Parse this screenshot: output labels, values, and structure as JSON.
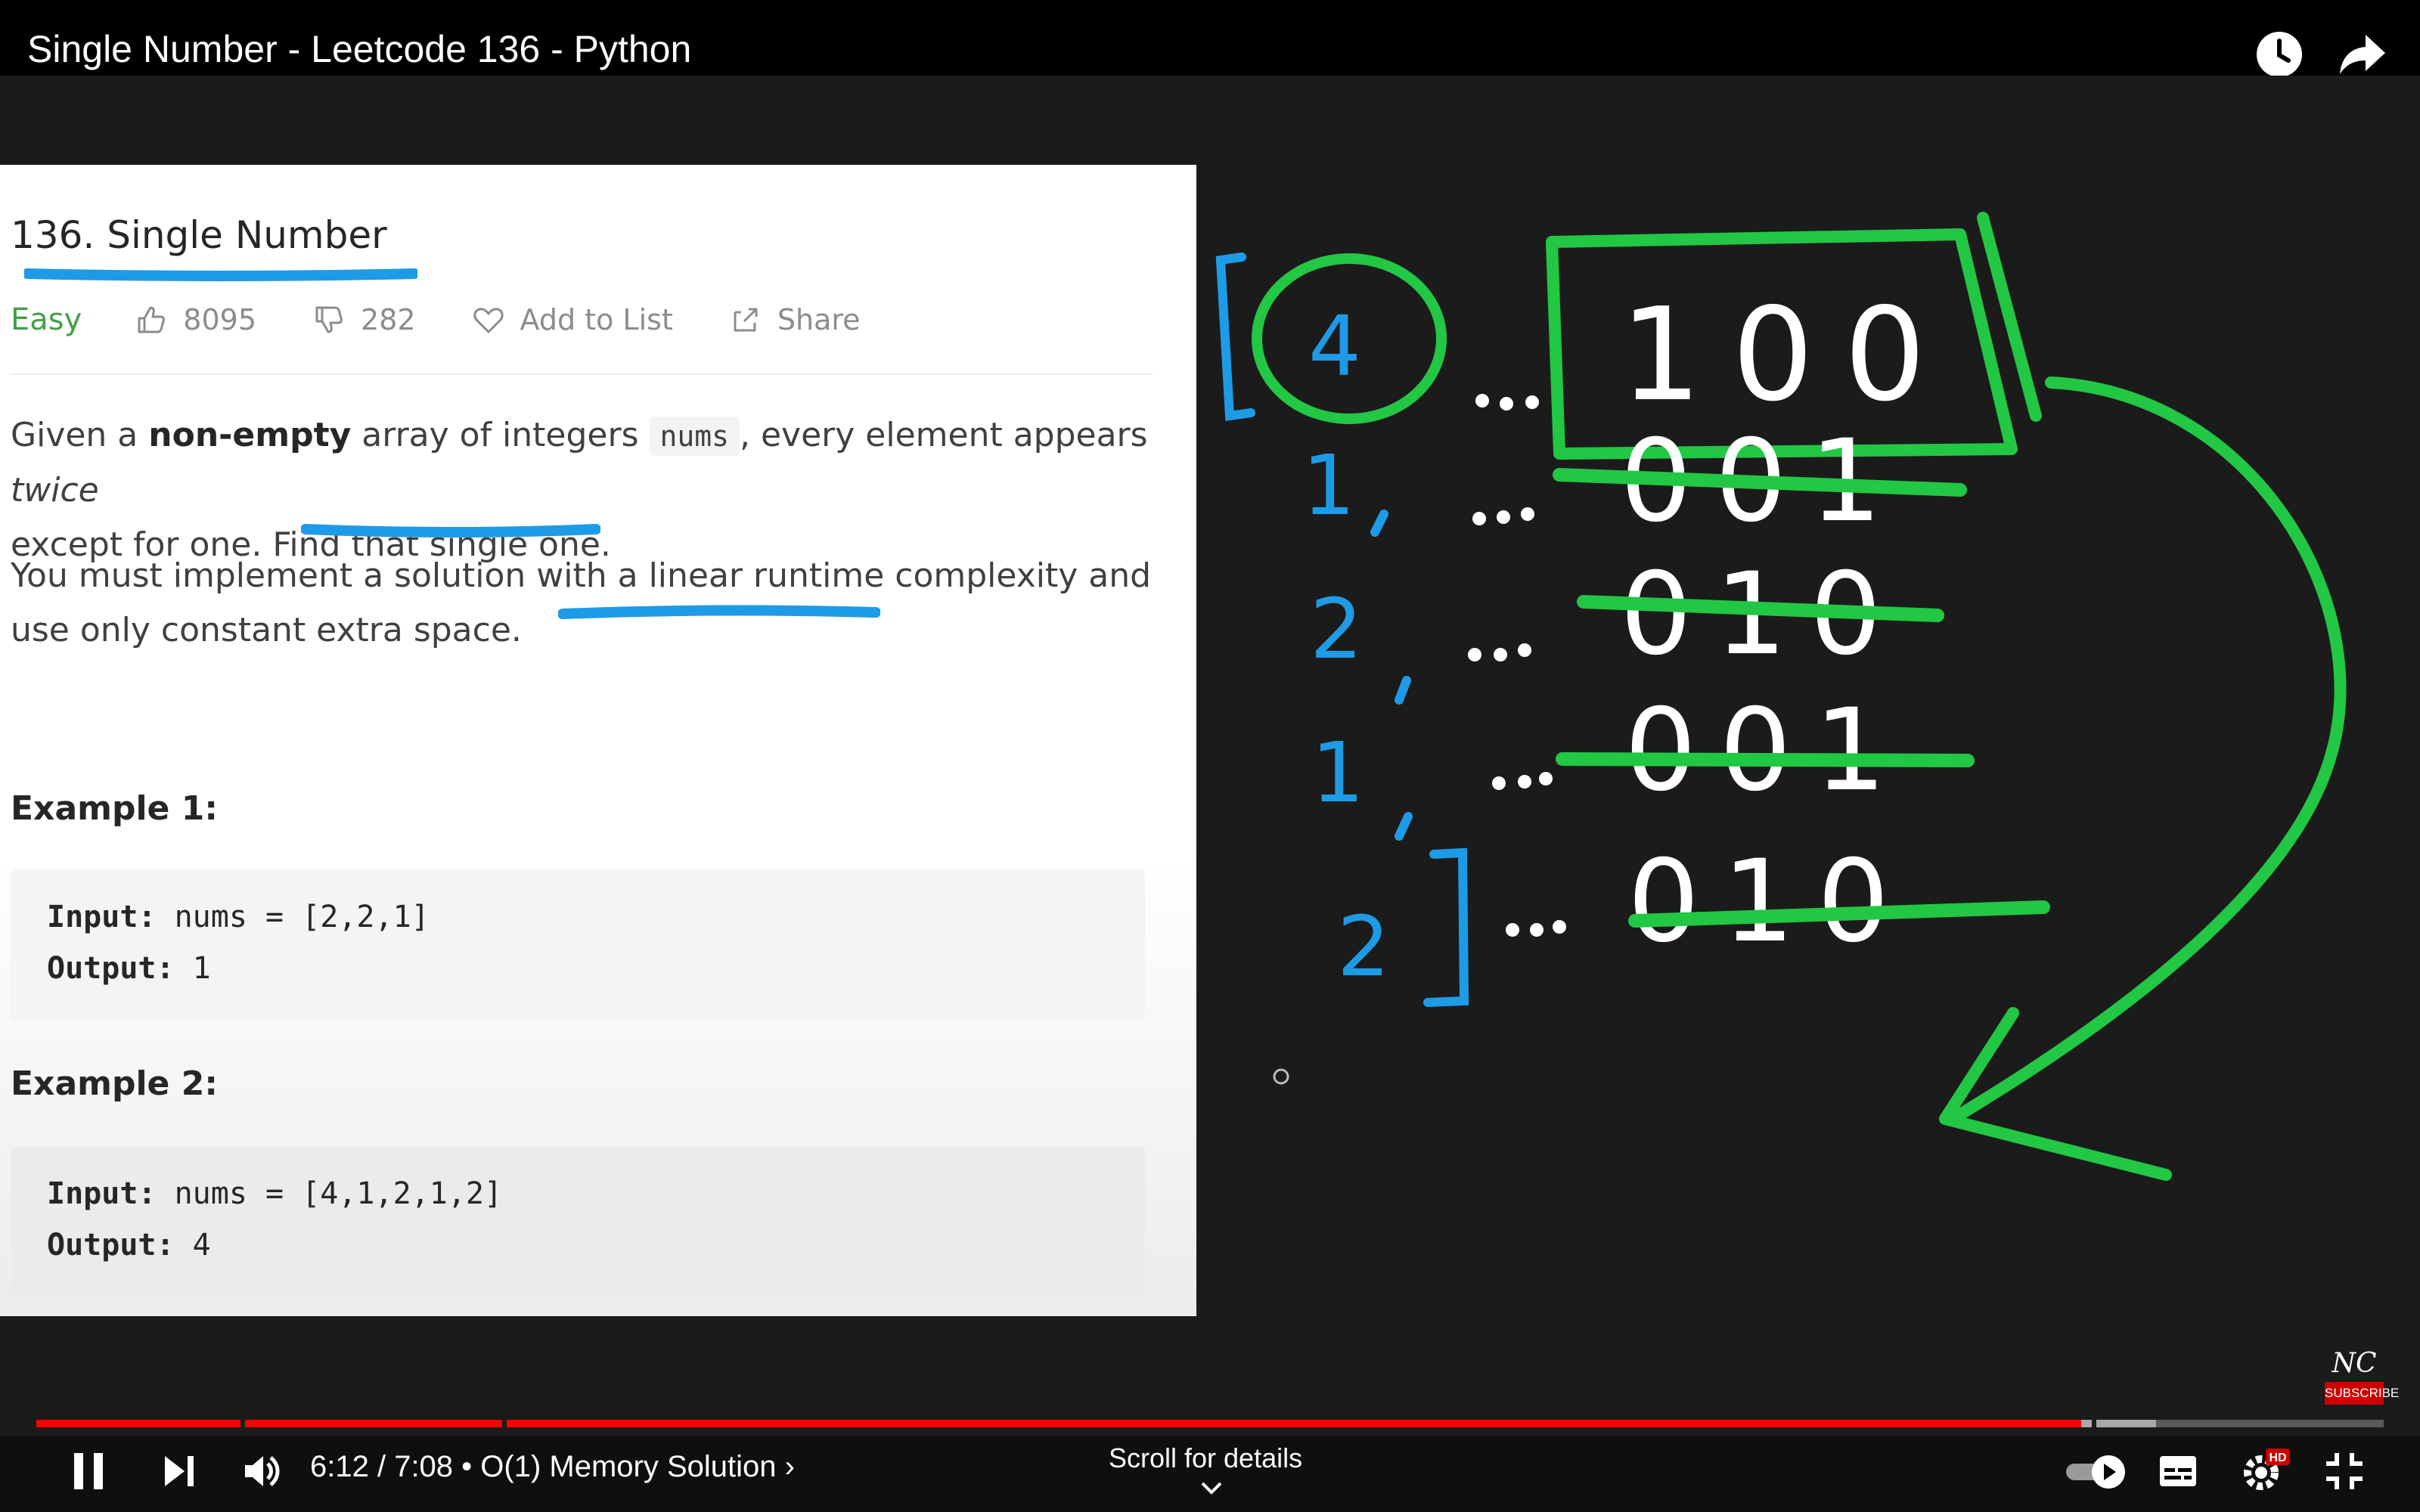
{
  "video": {
    "title": "Single Number - Leetcode 136 - Python",
    "time": "6:12 / 7:08",
    "chapter": "O(1) Memory Solution",
    "scroll_hint": "Scroll for details",
    "progress_fraction": 0.871,
    "buffer_fraction": 0.903
  },
  "problem": {
    "title": "136. Single Number",
    "difficulty": "Easy",
    "likes": "8095",
    "dislikes": "282",
    "add_to_list": "Add to List",
    "share": "Share",
    "desc1_a": "Given a ",
    "desc1_bold": "non-empty",
    "desc1_b": " array of integers ",
    "desc1_code": "nums",
    "desc1_c": ", every element appears ",
    "desc1_italic": "twice",
    "desc1_d": "except for one. Find that single one.",
    "desc2_a": "You must implement a solution with a linear runtime complexity and",
    "desc2_b": "use only constant extra space.",
    "example1_title": "Example 1:",
    "example1_input_label": "Input:",
    "example1_input": " nums = [2,2,1]",
    "example1_output_label": "Output:",
    "example1_output": " 1",
    "example2_title": "Example 2:",
    "example2_input_label": "Input:",
    "example2_input": " nums = [4,1,2,1,2]",
    "example2_output_label": "Output:",
    "example2_output": " 4"
  },
  "drawing": {
    "numbers": [
      "4",
      "1",
      "2",
      "1",
      "2"
    ],
    "result_bits": "100",
    "row_bits": [
      "001",
      "010",
      "001",
      "010"
    ]
  },
  "channel": {
    "logo": "NC",
    "subscribe": "SUBSCRIBE"
  },
  "colors": {
    "blue_ink": "#1e9be6",
    "green_ink": "#22c744",
    "progress_red": "#ff0000"
  },
  "icons": [
    "watch-later-icon",
    "share-icon",
    "pause-icon",
    "next-icon",
    "volume-icon",
    "autoplay-toggle-icon",
    "captions-icon",
    "settings-icon",
    "exit-fullscreen-icon",
    "thumbs-up-icon",
    "thumbs-down-icon",
    "heart-icon",
    "share-box-icon"
  ]
}
